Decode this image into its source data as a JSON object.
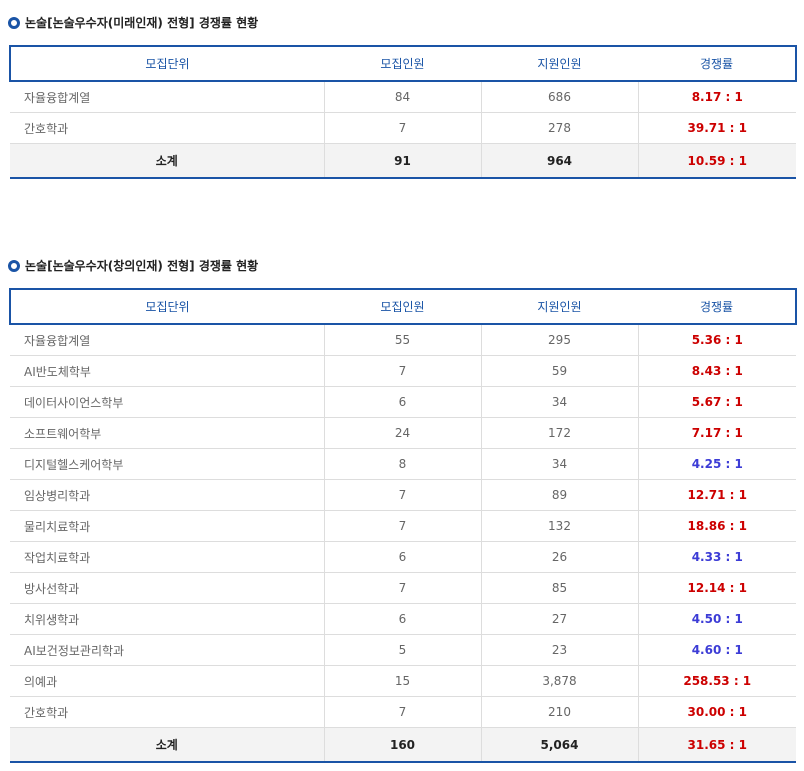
{
  "headers": [
    "모집단위",
    "모집인원",
    "지원인원",
    "경쟁률"
  ],
  "colors": {
    "accent": "#1a54a6",
    "ratio_high": "#cc0000",
    "ratio_low": "#3c3cd6"
  },
  "sections": [
    {
      "title": "논술[논술우수자(미래인재) 전형] 경쟁률 현황",
      "rows": [
        {
          "unit": "자율융합계열",
          "quota": "84",
          "applicants": "686",
          "ratio": "8.17 : 1",
          "tone": "red"
        },
        {
          "unit": "간호학과",
          "quota": "7",
          "applicants": "278",
          "ratio": "39.71 : 1",
          "tone": "red"
        }
      ],
      "total": {
        "unit": "소계",
        "quota": "91",
        "applicants": "964",
        "ratio": "10.59 : 1"
      }
    },
    {
      "title": "논술[논술우수자(창의인재) 전형] 경쟁률 현황",
      "rows": [
        {
          "unit": "자율융합계열",
          "quota": "55",
          "applicants": "295",
          "ratio": "5.36 : 1",
          "tone": "red"
        },
        {
          "unit": "AI반도체학부",
          "quota": "7",
          "applicants": "59",
          "ratio": "8.43 : 1",
          "tone": "red"
        },
        {
          "unit": "데이터사이언스학부",
          "quota": "6",
          "applicants": "34",
          "ratio": "5.67 : 1",
          "tone": "red"
        },
        {
          "unit": "소프트웨어학부",
          "quota": "24",
          "applicants": "172",
          "ratio": "7.17 : 1",
          "tone": "red"
        },
        {
          "unit": "디지털헬스케어학부",
          "quota": "8",
          "applicants": "34",
          "ratio": "4.25 : 1",
          "tone": "blue"
        },
        {
          "unit": "임상병리학과",
          "quota": "7",
          "applicants": "89",
          "ratio": "12.71 : 1",
          "tone": "red"
        },
        {
          "unit": "물리치료학과",
          "quota": "7",
          "applicants": "132",
          "ratio": "18.86 : 1",
          "tone": "red"
        },
        {
          "unit": "작업치료학과",
          "quota": "6",
          "applicants": "26",
          "ratio": "4.33 : 1",
          "tone": "blue"
        },
        {
          "unit": "방사선학과",
          "quota": "7",
          "applicants": "85",
          "ratio": "12.14 : 1",
          "tone": "red"
        },
        {
          "unit": "치위생학과",
          "quota": "6",
          "applicants": "27",
          "ratio": "4.50 : 1",
          "tone": "blue"
        },
        {
          "unit": "AI보건정보관리학과",
          "quota": "5",
          "applicants": "23",
          "ratio": "4.60 : 1",
          "tone": "blue"
        },
        {
          "unit": "의예과",
          "quota": "15",
          "applicants": "3,878",
          "ratio": "258.53 : 1",
          "tone": "red"
        },
        {
          "unit": "간호학과",
          "quota": "7",
          "applicants": "210",
          "ratio": "30.00 : 1",
          "tone": "red"
        }
      ],
      "total": {
        "unit": "소계",
        "quota": "160",
        "applicants": "5,064",
        "ratio": "31.65 : 1"
      }
    }
  ]
}
